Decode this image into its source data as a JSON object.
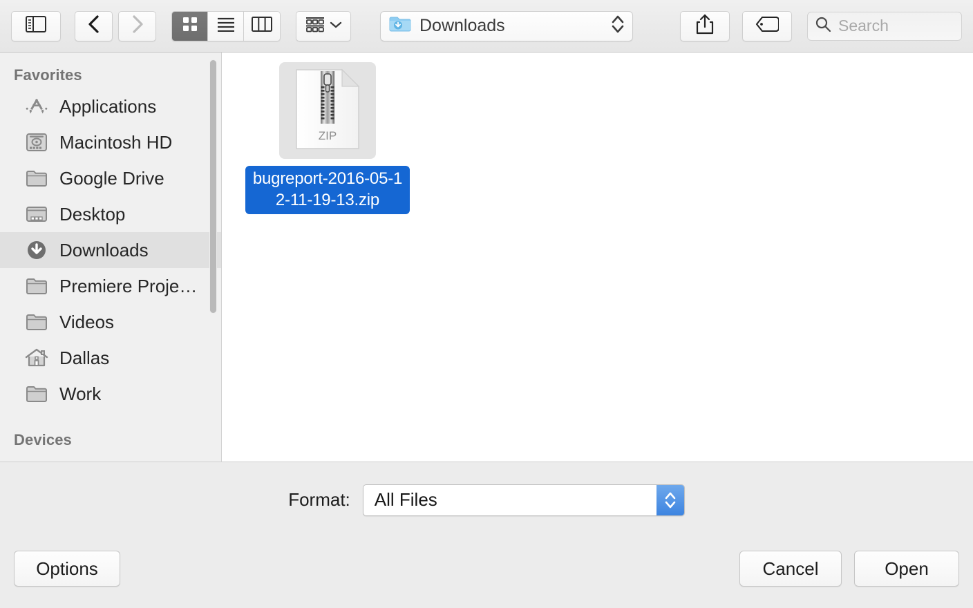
{
  "toolbar": {
    "sidebar_toggle": "sidebar-toggle-icon",
    "back": "back-chevron-icon",
    "forward": "forward-chevron-icon",
    "view_modes": [
      {
        "name": "icon-view",
        "icon": "grid-icon",
        "active": true
      },
      {
        "name": "list-view",
        "icon": "list-icon",
        "active": false
      },
      {
        "name": "column-view",
        "icon": "columns-icon",
        "active": false
      }
    ],
    "arrange": {
      "icon": "arrange-icon",
      "chevron": "chevron-down-icon"
    },
    "path": {
      "folder_icon": "downloads-folder-icon",
      "label": "Downloads",
      "stepper": "updown-arrows-icon"
    },
    "share": "share-icon",
    "tags": "tag-icon",
    "search": {
      "icon": "search-icon",
      "placeholder": "Search",
      "value": ""
    }
  },
  "sidebar": {
    "sections": [
      {
        "header": "Favorites",
        "items": [
          {
            "label": "Applications",
            "icon": "applications-icon",
            "selected": false
          },
          {
            "label": "Macintosh HD",
            "icon": "harddisk-icon",
            "selected": false
          },
          {
            "label": "Google Drive",
            "icon": "folder-icon",
            "selected": false
          },
          {
            "label": "Desktop",
            "icon": "desktop-icon",
            "selected": false
          },
          {
            "label": "Downloads",
            "icon": "downloads-icon",
            "selected": true
          },
          {
            "label": "Premiere Proje…",
            "icon": "folder-icon",
            "selected": false
          },
          {
            "label": "Videos",
            "icon": "folder-icon",
            "selected": false
          },
          {
            "label": "Dallas",
            "icon": "home-icon",
            "selected": false
          },
          {
            "label": "Work",
            "icon": "folder-icon",
            "selected": false
          }
        ]
      },
      {
        "header": "Devices",
        "items": []
      }
    ]
  },
  "content": {
    "files": [
      {
        "name": "bugreport-2016-05-12-11-19-13.zip",
        "icon": "zip-file-icon",
        "badge": "ZIP",
        "selected": true
      }
    ]
  },
  "bottom": {
    "format_label": "Format:",
    "format_value": "All Files",
    "options_label": "Options",
    "cancel_label": "Cancel",
    "open_label": "Open"
  },
  "colors": {
    "selection_blue": "#1567d3",
    "stepper_blue": "#3d84e0",
    "toolbar_bg": "#ececec",
    "sidebar_bg": "#f0f0f0"
  }
}
